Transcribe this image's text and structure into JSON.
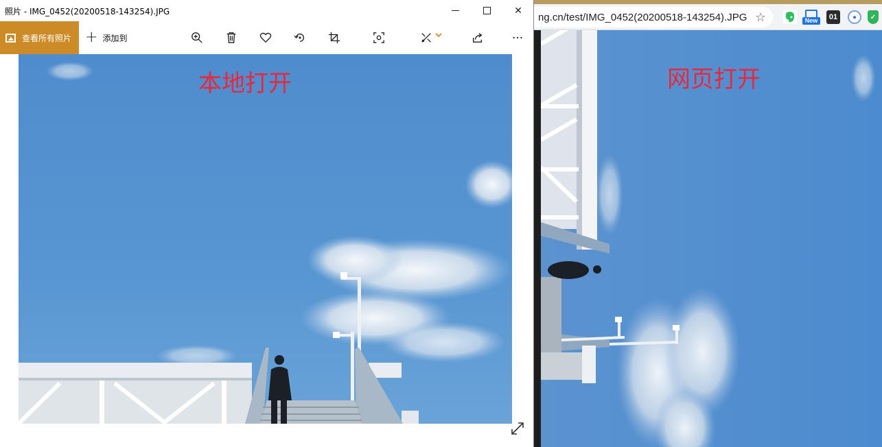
{
  "photos_app": {
    "title": "照片 - IMG_0452(20200518-143254).JPG",
    "toolbar": {
      "view_all_label": "查看所有照片",
      "add_to_label": "添加到",
      "icons": [
        "zoom-in-icon",
        "delete-icon",
        "heart-icon",
        "rotate-icon",
        "crop-icon",
        "enhance-icon",
        "edit-icon",
        "share-icon",
        "more-icon"
      ]
    },
    "accent_color": "#cc8b27"
  },
  "browser": {
    "url_visible": "ng.cn/test/IMG_0452(20200518-143254).JPG",
    "extension_new_label": "New",
    "extension_zero_label": "01"
  },
  "annotations": {
    "local_label": "本地打开",
    "web_label": "网页打开",
    "label_color": "#e8283c"
  }
}
